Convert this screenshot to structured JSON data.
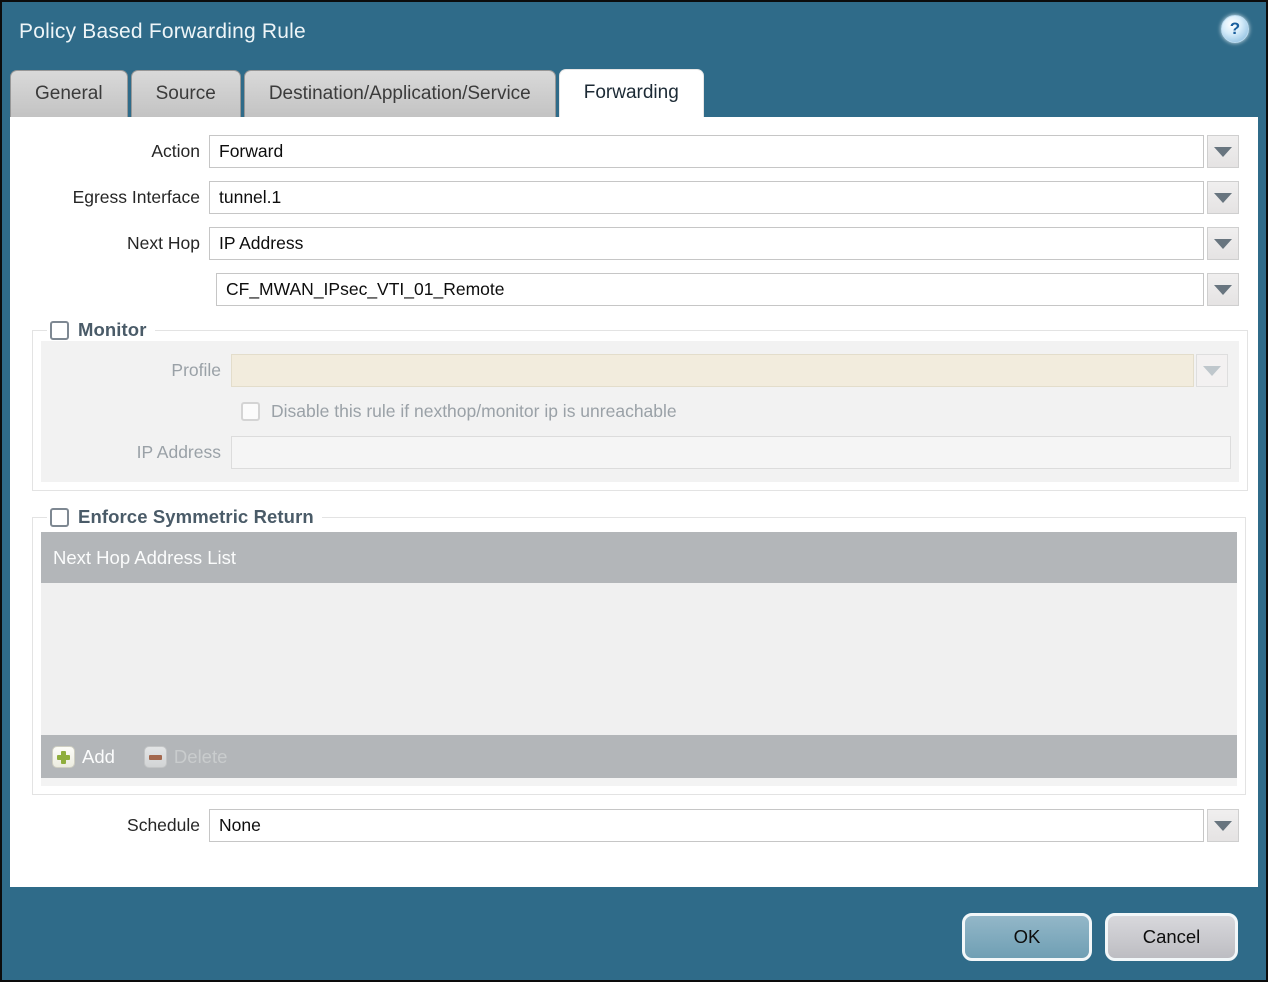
{
  "dialog": {
    "title": "Policy Based Forwarding Rule",
    "help_glyph": "?"
  },
  "tabs": [
    {
      "label": "General",
      "active": false
    },
    {
      "label": "Source",
      "active": false
    },
    {
      "label": "Destination/Application/Service",
      "active": false
    },
    {
      "label": "Forwarding",
      "active": true
    }
  ],
  "form": {
    "action": {
      "label": "Action",
      "value": "Forward"
    },
    "egress_interface": {
      "label": "Egress Interface",
      "value": "tunnel.1"
    },
    "next_hop": {
      "label": "Next Hop",
      "value": "IP Address"
    },
    "next_hop_address": {
      "value": "CF_MWAN_IPsec_VTI_01_Remote"
    },
    "schedule": {
      "label": "Schedule",
      "value": "None"
    }
  },
  "monitor": {
    "legend": "Monitor",
    "checked": false,
    "profile": {
      "label": "Profile",
      "value": ""
    },
    "disable_rule": {
      "label": "Disable this rule if nexthop/monitor ip is unreachable",
      "checked": false
    },
    "ip_address": {
      "label": "IP Address",
      "value": ""
    }
  },
  "symmetric_return": {
    "legend": "Enforce Symmetric Return",
    "checked": false,
    "table_header": "Next Hop Address List",
    "rows": [],
    "add_label": "Add",
    "delete_label": "Delete",
    "delete_enabled": false
  },
  "footer": {
    "ok_label": "OK",
    "cancel_label": "Cancel"
  },
  "colors": {
    "titlebar": "#2f6b89",
    "active_tab_bg": "#ffffff",
    "inactive_tab_bg": "#c9c9c9",
    "table_header_bg": "#b3b6b9",
    "disabled_profile_field_bg": "#f2ecdd",
    "ok_button_bg": "#7da9bd",
    "cancel_button_bg": "#c9c9cd",
    "add_icon_green": "#8fae3d",
    "delete_icon_red": "#a3684e"
  }
}
